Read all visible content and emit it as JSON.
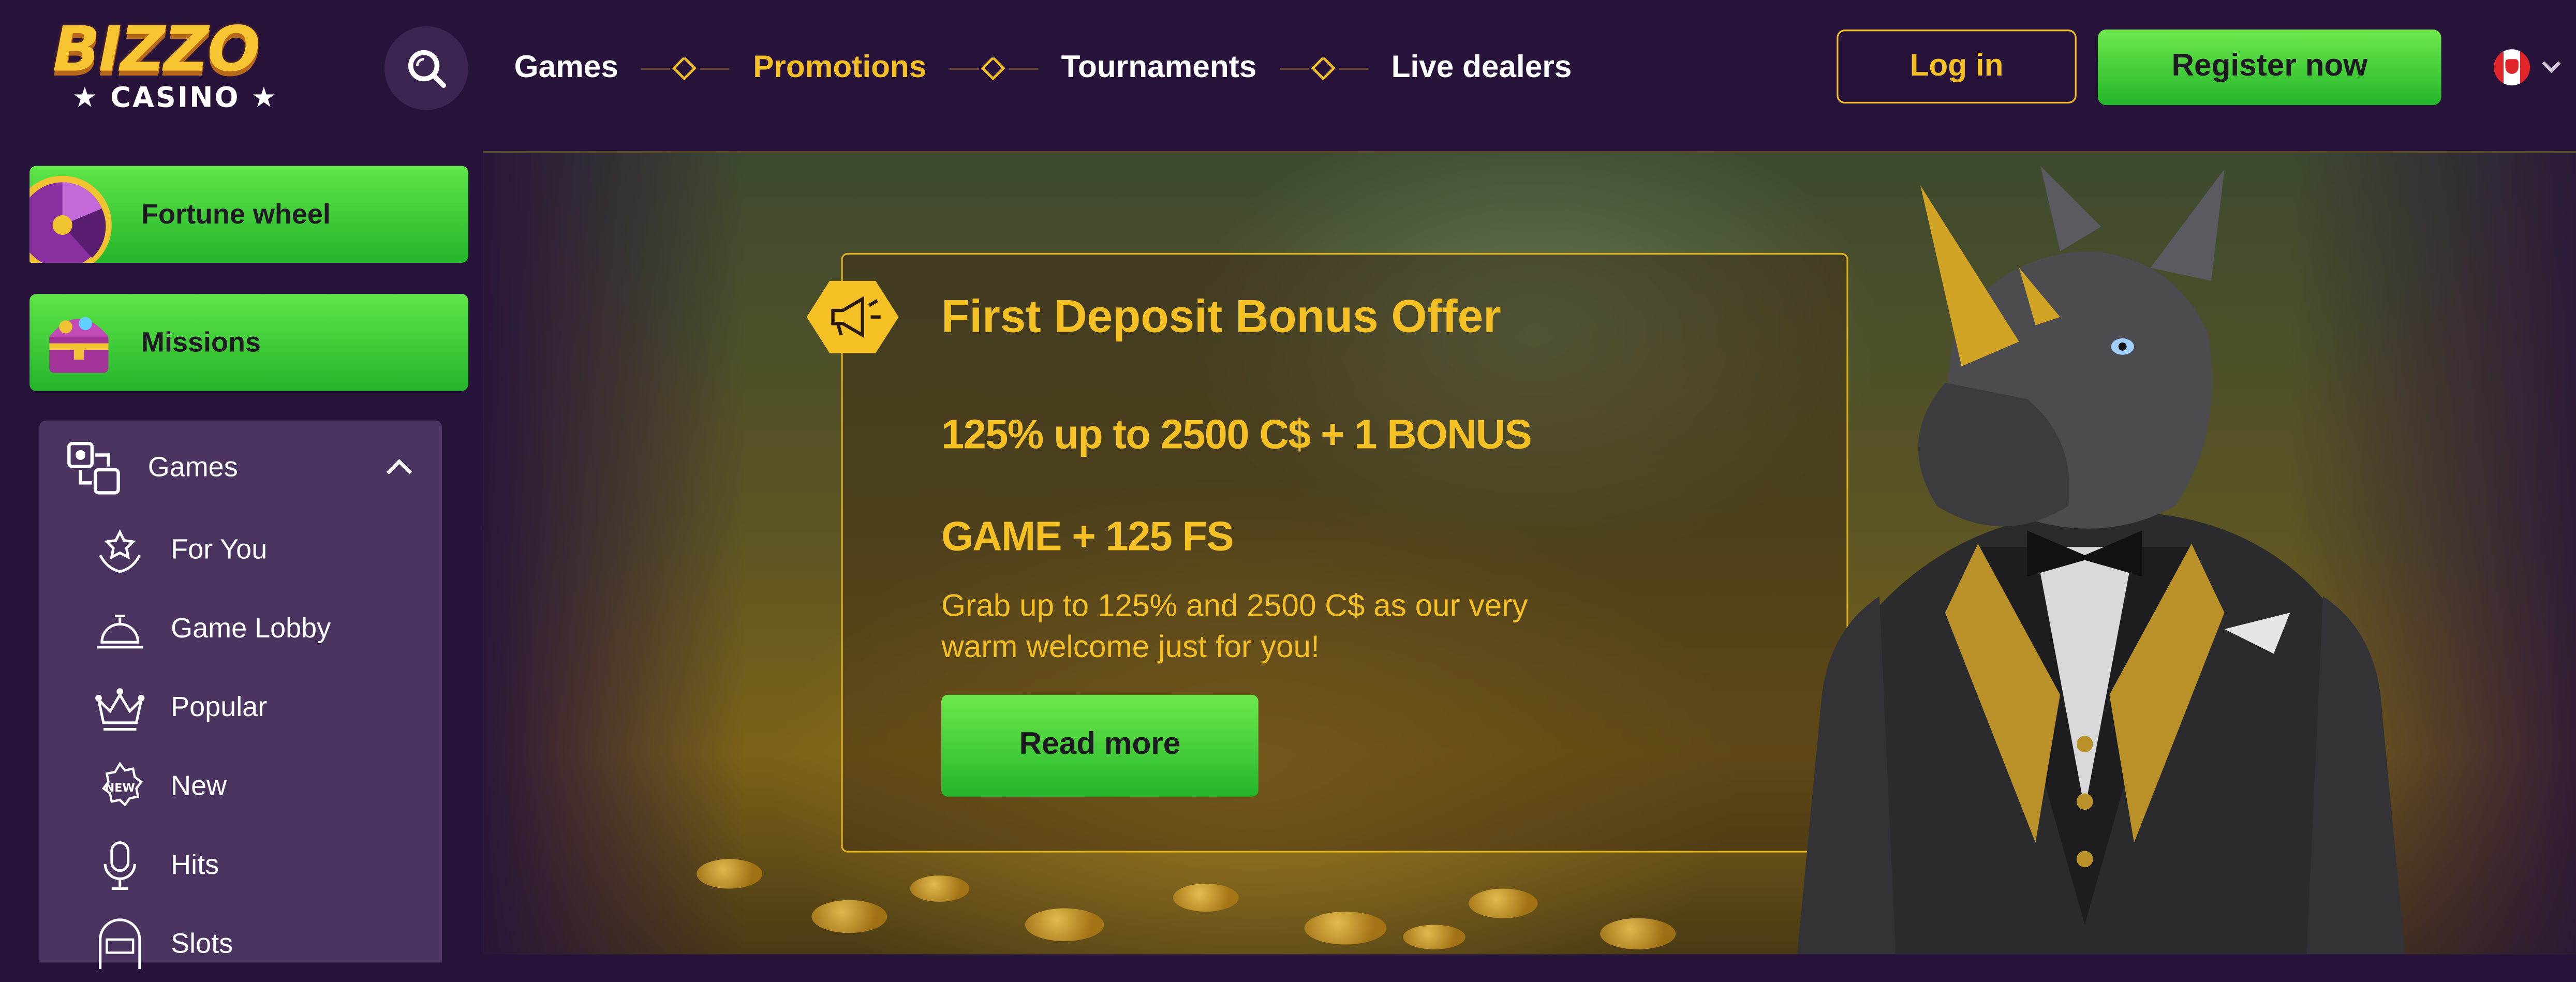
{
  "brand": {
    "logo_top": "BIZZO",
    "logo_bottom": "★ CASINO ★",
    "accent": "#f5c024",
    "cta_green": "#3fd23a",
    "background": "#27123a"
  },
  "header": {
    "search_icon": "search-icon",
    "nav": [
      {
        "label": "Games",
        "active": false
      },
      {
        "label": "Promotions",
        "active": true
      },
      {
        "label": "Tournaments",
        "active": false
      },
      {
        "label": "Live dealers",
        "active": false
      }
    ],
    "login_label": "Log in",
    "register_label": "Register now",
    "language_icon": "canada-flag-icon"
  },
  "sidebar": {
    "fortune_wheel_label": "Fortune wheel",
    "missions_label": "Missions",
    "games_section": {
      "label": "Games",
      "expanded": true,
      "items": [
        {
          "label": "For You",
          "icon": "star-hands-icon"
        },
        {
          "label": "Game Lobby",
          "icon": "service-bell-icon"
        },
        {
          "label": "Popular",
          "icon": "crown-icon"
        },
        {
          "label": "New",
          "icon": "new-badge-icon"
        },
        {
          "label": "Hits",
          "icon": "microphone-icon"
        },
        {
          "label": "Slots",
          "icon": "slot-machine-icon"
        }
      ]
    }
  },
  "banner": {
    "title": "First Deposit Bonus Offer",
    "subtitle_line1": "125% up to 2500 C$ + 1 BONUS",
    "subtitle_line2": "GAME + 125 FS",
    "description": "Grab up to 125% and 2500 C$ as our very warm welcome just for you!",
    "button_label": "Read more",
    "badge_icon": "megaphone-icon",
    "mascot": "rhino-in-tuxedo-illustration"
  }
}
